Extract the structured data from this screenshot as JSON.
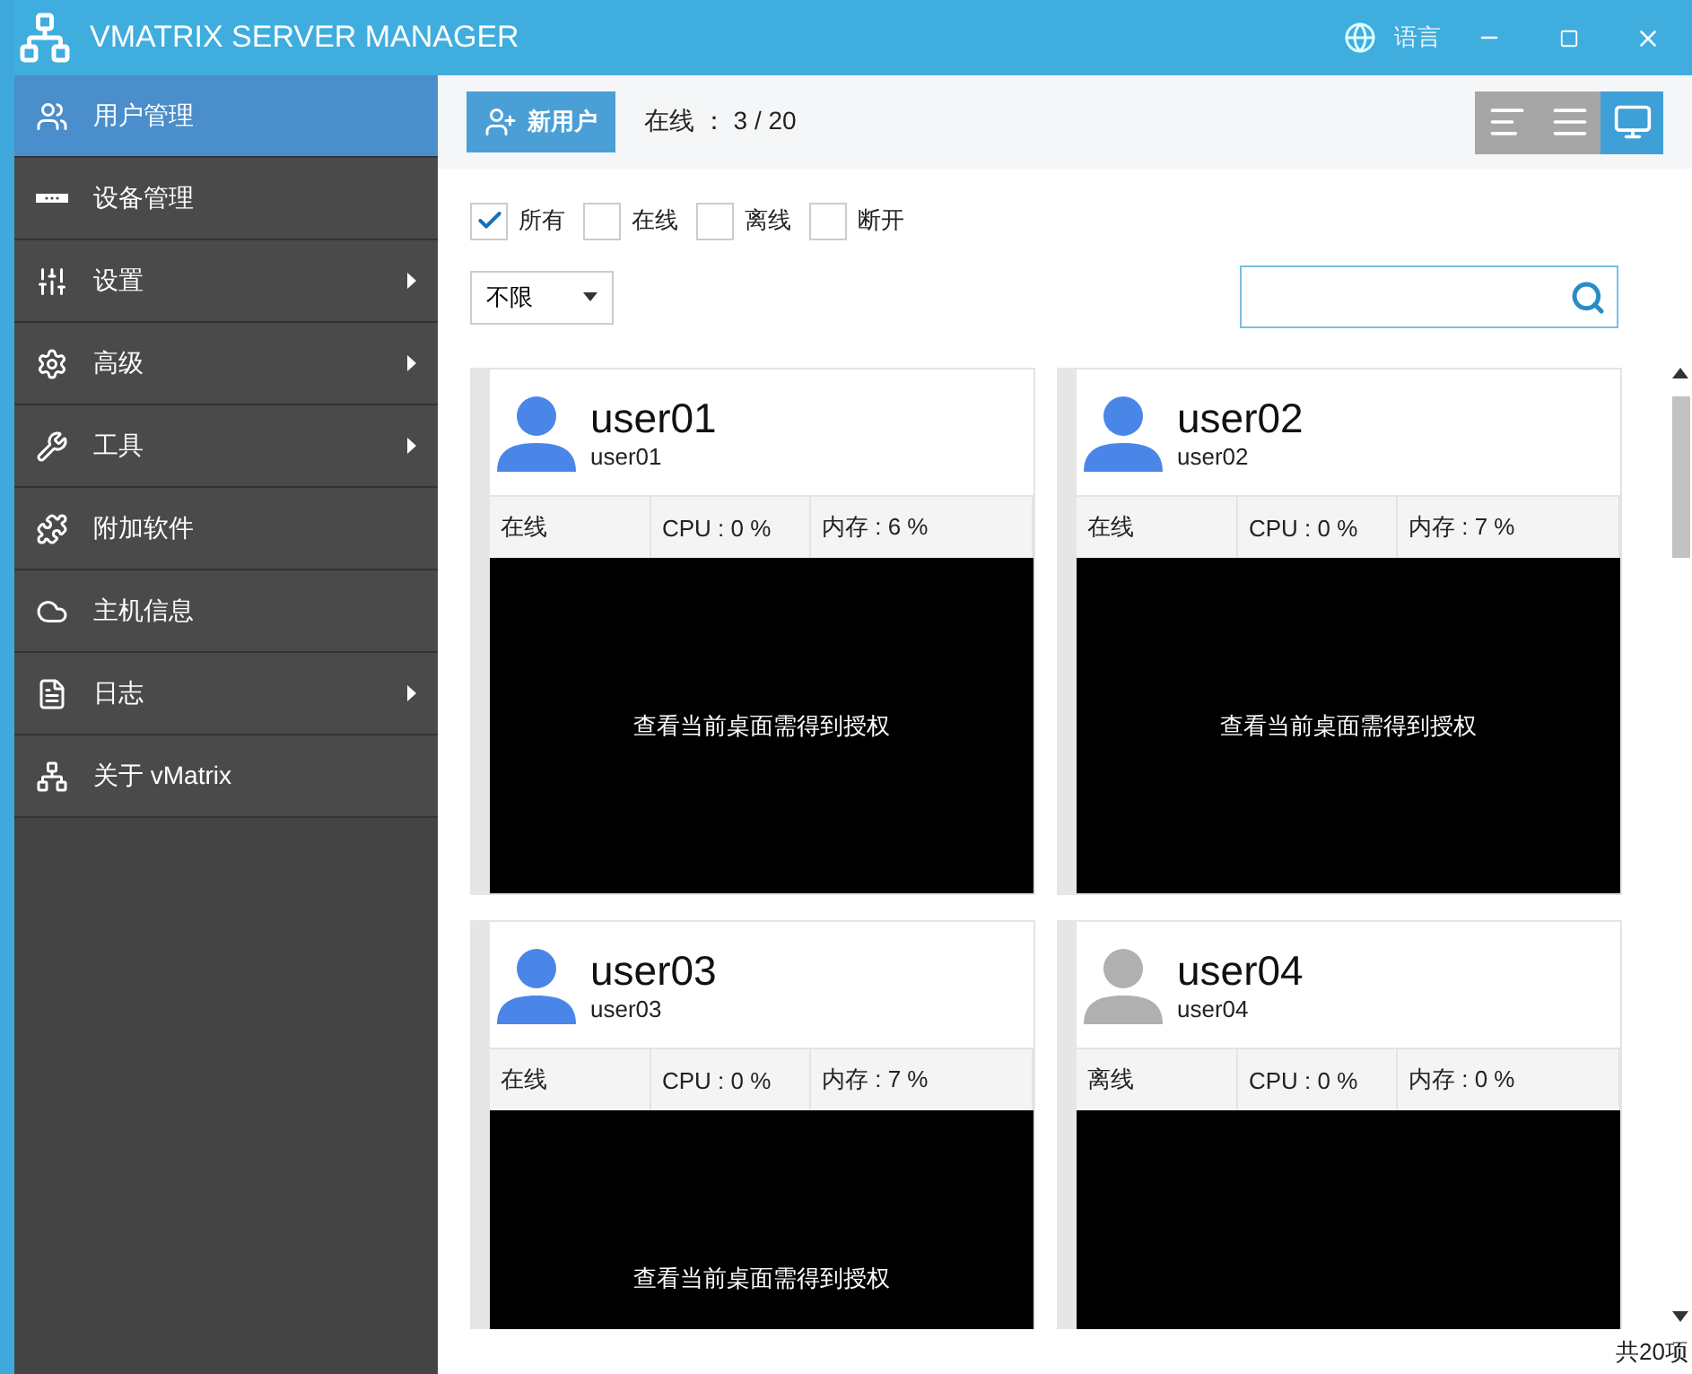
{
  "window": {
    "title": "VMATRIX SERVER MANAGER",
    "language_label": "语言"
  },
  "sidebar": {
    "items": [
      {
        "label": "用户管理",
        "selected": true,
        "has_submenu": false
      },
      {
        "label": "设备管理",
        "selected": false,
        "has_submenu": false
      },
      {
        "label": "设置",
        "selected": false,
        "has_submenu": true
      },
      {
        "label": "高级",
        "selected": false,
        "has_submenu": true
      },
      {
        "label": "工具",
        "selected": false,
        "has_submenu": true
      },
      {
        "label": "附加软件",
        "selected": false,
        "has_submenu": false
      },
      {
        "label": "主机信息",
        "selected": false,
        "has_submenu": false
      },
      {
        "label": "日志",
        "selected": false,
        "has_submenu": true
      },
      {
        "label": "关于 vMatrix",
        "selected": false,
        "has_submenu": false
      }
    ]
  },
  "toolbar": {
    "new_user_button": "新用户",
    "online_count": "在线 ： 3 / 20",
    "view_modes": [
      {
        "kind": "list",
        "selected": false
      },
      {
        "kind": "detail",
        "selected": false
      },
      {
        "kind": "desktop",
        "selected": true
      }
    ]
  },
  "filters": [
    {
      "label": "所有",
      "checked": true
    },
    {
      "label": "在线",
      "checked": false
    },
    {
      "label": "离线",
      "checked": false
    },
    {
      "label": "断开",
      "checked": false
    }
  ],
  "range_dropdown": {
    "value": "不限"
  },
  "users": [
    {
      "name": "user01",
      "account": "user01",
      "online": true,
      "status": "在线",
      "cpu": "CPU : 0 %",
      "memory": "内存 : 6 %",
      "preview_message": "查看当前桌面需得到授权"
    },
    {
      "name": "user02",
      "account": "user02",
      "online": true,
      "status": "在线",
      "cpu": "CPU : 0 %",
      "memory": "内存 : 7 %",
      "preview_message": "查看当前桌面需得到授权"
    },
    {
      "name": "user03",
      "account": "user03",
      "online": true,
      "status": "在线",
      "cpu": "CPU : 0 %",
      "memory": "内存 : 7 %",
      "preview_message": "查看当前桌面需得到授权"
    },
    {
      "name": "user04",
      "account": "user04",
      "online": false,
      "status": "离线",
      "cpu": "CPU : 0 %",
      "memory": "内存 : 0 %"
    }
  ],
  "footer": {
    "total": "共20项"
  }
}
